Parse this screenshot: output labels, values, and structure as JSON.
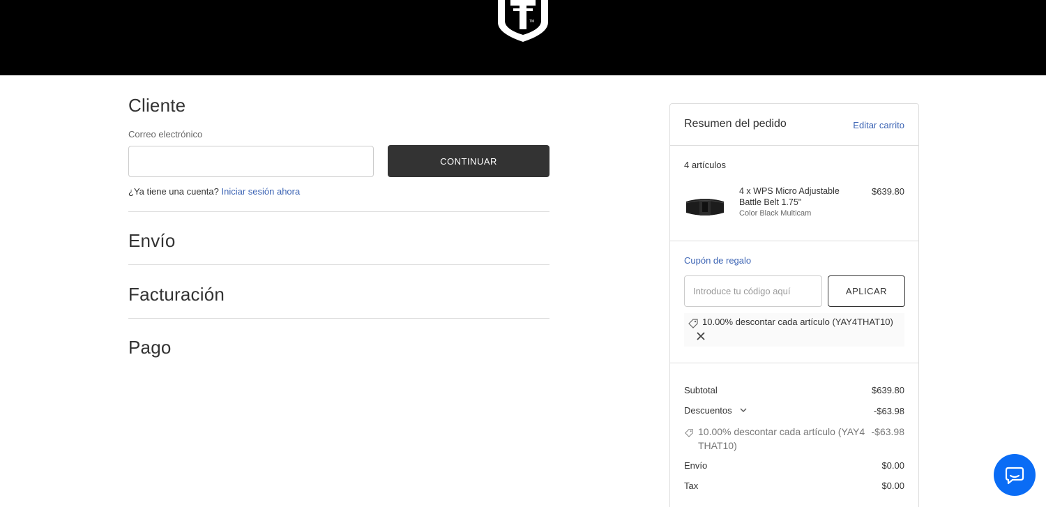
{
  "brand": {
    "logo_icon": "shield-logo-icon"
  },
  "customer": {
    "title": "Cliente",
    "email_label": "Correo electrónico",
    "email_value": "",
    "continue_label": "CONTINUAR",
    "have_account": "¿Ya tiene una cuenta?",
    "sign_in_link": "Iniciar sesión ahora"
  },
  "sections": {
    "shipping": "Envío",
    "billing": "Facturación",
    "payment": "Pago"
  },
  "summary": {
    "title": "Resumen del pedido",
    "edit_cart": "Editar carrito",
    "items_count": "4 artículos",
    "product": {
      "name": "4 x WPS Micro Adjustable Battle Belt 1.75\"",
      "option": "Color Black Multicam",
      "price": "$639.80"
    },
    "coupon": {
      "link": "Cupón de regalo",
      "placeholder": "Introduce tu código aquí",
      "apply_label": "APLICAR",
      "applied_text": "10.00% descontar cada artículo (YAY4THAT10)"
    },
    "totals": {
      "subtotal_label": "Subtotal",
      "subtotal_value": "$639.80",
      "discounts_label": "Descuentos",
      "discounts_value": "-$63.98",
      "discount_line_text": "10.00% descontar cada artículo (YAY4THAT10)",
      "discount_line_value": "-$63.98",
      "shipping_label": "Envío",
      "shipping_value": "$0.00",
      "tax_label": "Tax",
      "tax_value": "$0.00"
    }
  },
  "colors": {
    "link": "#3c64b4",
    "button_dark": "#333333",
    "chat": "#0a6cf5"
  }
}
